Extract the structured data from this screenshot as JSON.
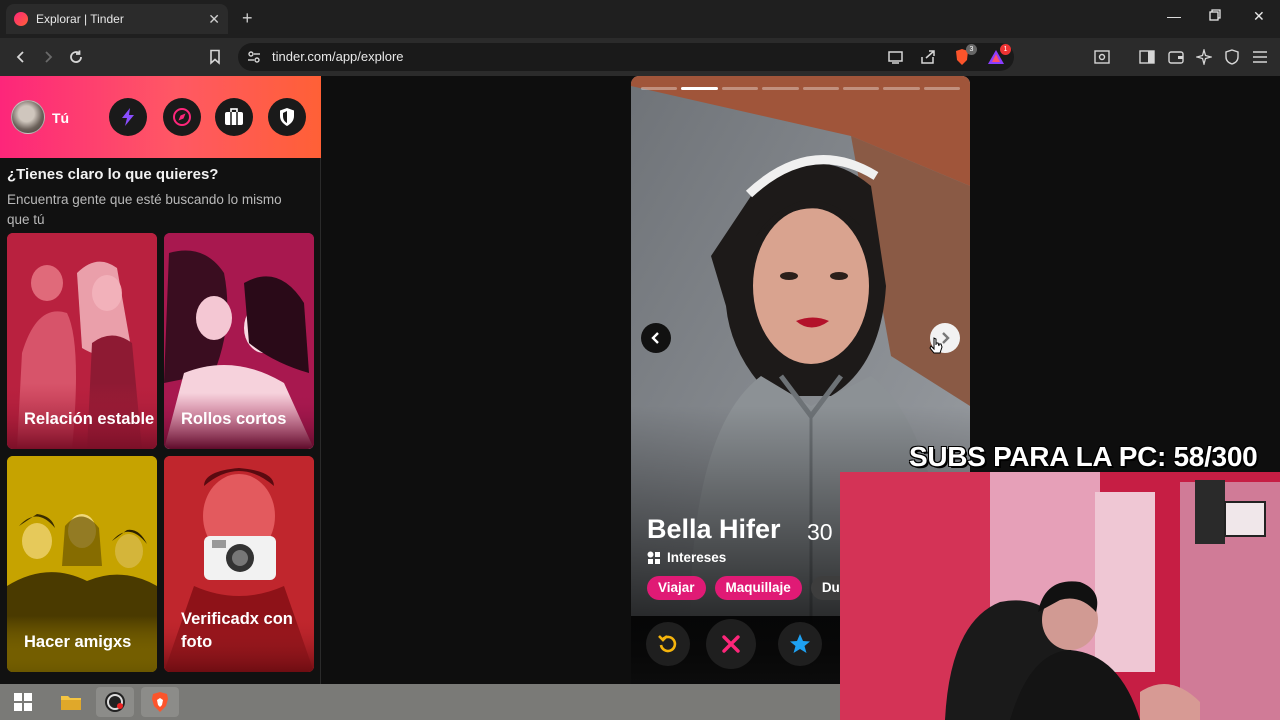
{
  "browser": {
    "tab_title": "Explorar | Tinder",
    "tab_close": "✕",
    "new_tab": "+",
    "url": "tinder.com/app/explore",
    "shield_badge": "3",
    "alert_badge": "1"
  },
  "sidebar": {
    "user_label": "Tú",
    "question_title": "¿Tienes claro lo que quieres?",
    "question_subtitle": "Encuentra gente que esté buscando lo mismo que tú",
    "cards": [
      {
        "label": "Relación estable",
        "color": "#c9284a"
      },
      {
        "label": "Rollos cortos",
        "color": "#c21f62"
      },
      {
        "label": "Hacer amigxs",
        "color": "#c4a200"
      },
      {
        "label": "Verificadx con foto",
        "color": "#c8283a"
      }
    ]
  },
  "profile": {
    "name": "Bella Hifer",
    "age": "30",
    "interests_label": "Intereses",
    "interests": [
      "Viajar",
      "Maquillaje",
      "Dul"
    ],
    "photo_count": 8,
    "active_photo": 2
  },
  "overlay": {
    "subs_text": "SUBS PARA LA PC: 58/300"
  },
  "colors": {
    "brand_start": "#fd267a",
    "brand_end": "#ff6036",
    "chip": "#e01a75"
  }
}
